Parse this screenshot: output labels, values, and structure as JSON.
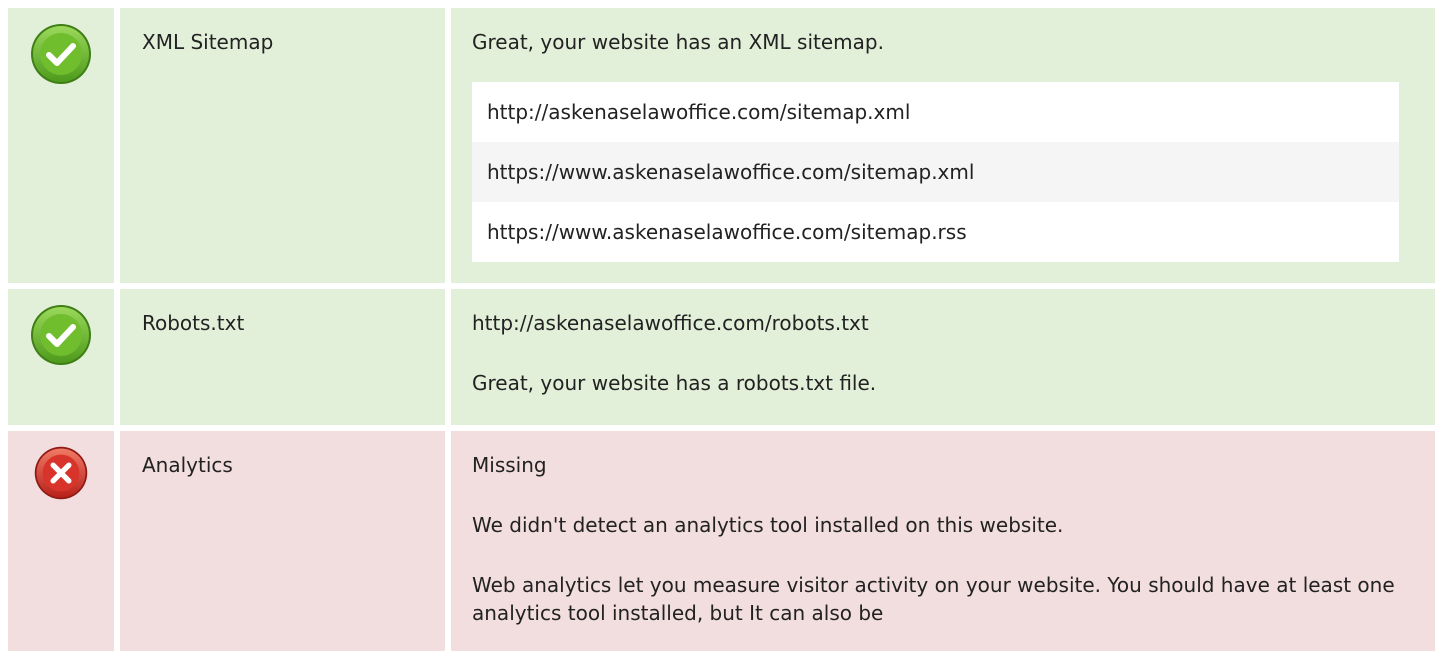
{
  "checks": {
    "sitemap": {
      "name": "XML Sitemap",
      "status_icon": "check-circle-icon",
      "message": "Great, your website has an XML sitemap.",
      "urls": [
        "http://askenaselawoffice.com/sitemap.xml",
        "https://www.askenaselawoffice.com/sitemap.xml",
        "https://www.askenaselawoffice.com/sitemap.rss"
      ]
    },
    "robots": {
      "name": "Robots.txt",
      "status_icon": "check-circle-icon",
      "url": "http://askenaselawoffice.com/robots.txt",
      "message": "Great, your website has a robots.txt file."
    },
    "analytics": {
      "name": "Analytics",
      "status_icon": "cross-circle-icon",
      "status": "Missing",
      "message": "We didn't detect an analytics tool installed on this website.",
      "advice": "Web analytics let you measure visitor activity on your website. You should have at least one analytics tool installed, but It can also be"
    }
  },
  "colors": {
    "pass_background": "#e2f0da",
    "fail_background": "#f2dede",
    "pass_icon": "#6cbd2b",
    "fail_icon": "#d9342b"
  }
}
